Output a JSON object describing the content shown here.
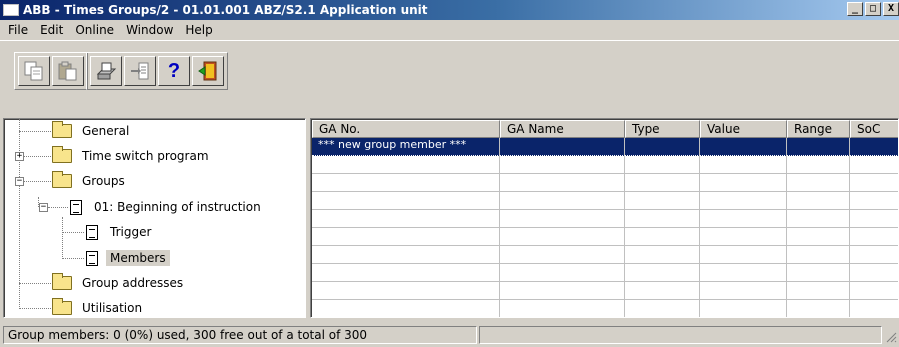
{
  "window": {
    "title": "ABB - Times Groups/2 - 01.01.001 ABZ/S2.1 Application unit",
    "controls": {
      "minimize": "_",
      "maximize": "□",
      "close": "X"
    }
  },
  "menu": {
    "items": [
      {
        "label": "File",
        "mnemonic": "F"
      },
      {
        "label": "Edit",
        "mnemonic": "E"
      },
      {
        "label": "Online",
        "mnemonic": "O"
      },
      {
        "label": "Window",
        "mnemonic": "W"
      },
      {
        "label": "Help",
        "mnemonic": "H"
      }
    ]
  },
  "toolbar": {
    "buttons": [
      {
        "icon": "copy-icon"
      },
      {
        "icon": "paste-icon"
      },
      {
        "icon": "print-icon"
      },
      {
        "icon": "import-icon"
      },
      {
        "icon": "help-icon",
        "glyph": "?"
      },
      {
        "icon": "exit-icon"
      }
    ]
  },
  "tree": {
    "nodes": [
      {
        "label": "General",
        "icon": "folder-icon"
      },
      {
        "label": "Time switch program",
        "icon": "folder-icon",
        "expander": "+"
      },
      {
        "label": "Groups",
        "icon": "folder-icon",
        "expander": "−"
      },
      {
        "label": "01: Beginning of instruction",
        "icon": "document-icon",
        "expander": "−"
      },
      {
        "label": "Trigger",
        "icon": "document-icon"
      },
      {
        "label": "Members",
        "icon": "document-icon",
        "selected": true
      },
      {
        "label": "Group addresses",
        "icon": "folder-icon"
      },
      {
        "label": "Utilisation",
        "icon": "folder-icon"
      }
    ]
  },
  "grid": {
    "columns": [
      "GA No.",
      "GA Name",
      "Type",
      "Value",
      "Range",
      "SoC"
    ],
    "rows": [
      [
        "*** new group member ***",
        "",
        "",
        "",
        "",
        ""
      ]
    ]
  },
  "status": {
    "text": "Group members: 0 (0%) used, 300 free out of a total of 300",
    "right": ""
  },
  "colors": {
    "title_gradient_start": "#0a246a",
    "title_gradient_end": "#a6caf0",
    "selection": "#0a246a",
    "face": "#d4d0c8"
  }
}
